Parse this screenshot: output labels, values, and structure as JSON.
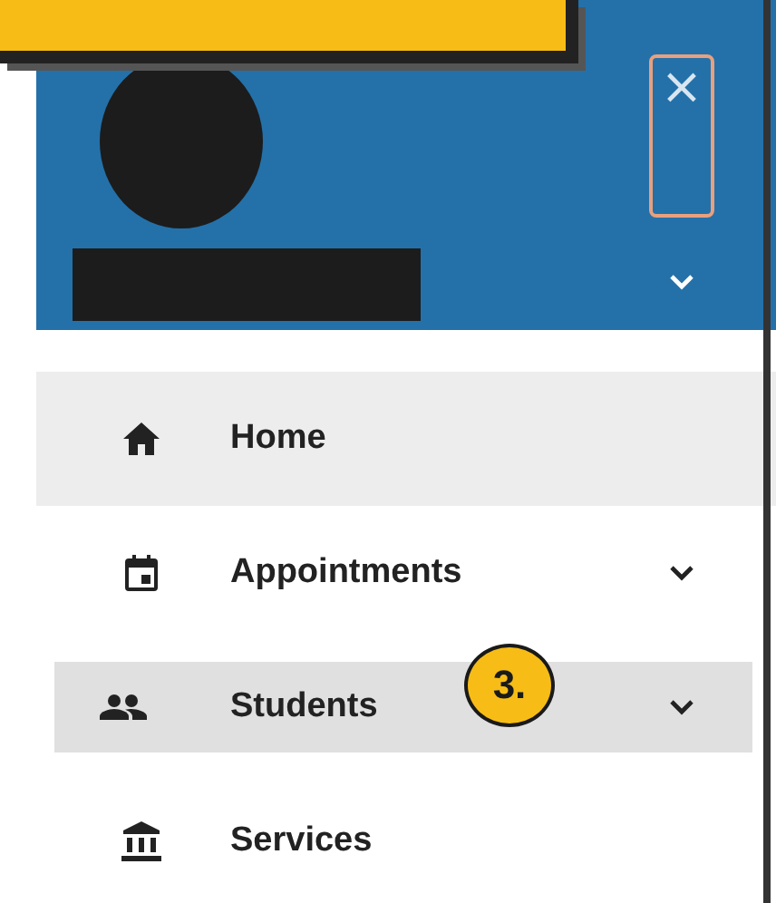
{
  "header": {
    "close_button": "×",
    "expanded": false
  },
  "menu": [
    {
      "label": "Home",
      "kind": "home",
      "selected": true,
      "highlighted": false,
      "expandable": false
    },
    {
      "label": "Appointments",
      "kind": "calendar",
      "selected": false,
      "highlighted": false,
      "expandable": true
    },
    {
      "label": "Students",
      "kind": "people",
      "selected": false,
      "highlighted": true,
      "expandable": true
    },
    {
      "label": "Services",
      "kind": "bank",
      "selected": false,
      "highlighted": false,
      "expandable": false
    }
  ],
  "callout": {
    "label": "3."
  }
}
